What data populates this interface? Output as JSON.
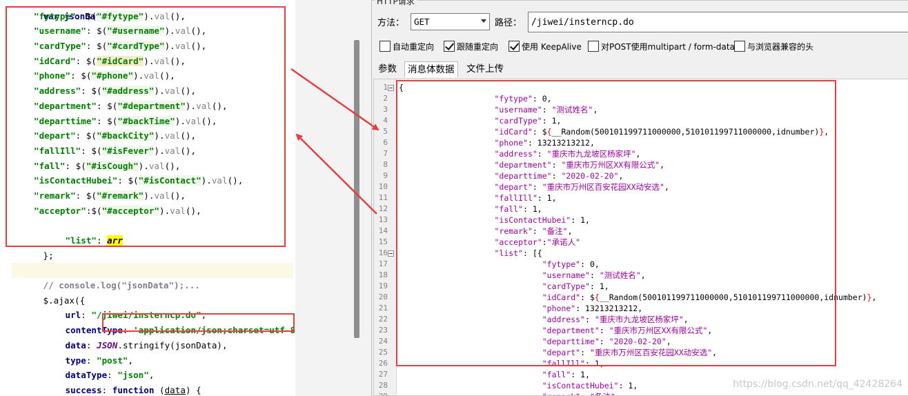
{
  "left_editor": {
    "line_partial": "var jsonData = {",
    "fields": [
      {
        "key": "\"fytype\"",
        "sel": "\"#fytype\""
      },
      {
        "key": "\"username\"",
        "sel": "\"#username\""
      },
      {
        "key": "\"cardType\"",
        "sel": "\"#cardType\""
      },
      {
        "key": "\"idCard\"",
        "sel": "\"#idCard\""
      },
      {
        "key": "\"phone\"",
        "sel": "\"#phone\""
      },
      {
        "key": "\"address\"",
        "sel": "\"#address\""
      },
      {
        "key": "\"department\"",
        "sel": "\"#department\""
      },
      {
        "key": "\"departtime\"",
        "sel": "\"#backTime\""
      },
      {
        "key": "\"depart\"",
        "sel": "\"#backCity\""
      },
      {
        "key": "\"fallIll\"",
        "sel": "\"#isFever\""
      },
      {
        "key": "\"fall\"",
        "sel": "\"#isCough\""
      },
      {
        "key": "\"isContactHubei\"",
        "sel": "\"#isContact\""
      },
      {
        "key": "\"remark\"",
        "sel": "\"#remark\""
      },
      {
        "key": "\"acceptor\"",
        "sel": "\"#acceptor\""
      }
    ],
    "list_key": "\"list\"",
    "list_val": "arr",
    "close": "};",
    "comment": "// console.log(\"jsonData\");...",
    "ajax_open": "$.ajax({",
    "url_key": "url",
    "url_val": "\"/jiwei/insterncp.do\"",
    "ct_key": "contentType",
    "ct_val": "'application/json;charset=utf-8'",
    "data_key": "data",
    "data_json": "JSON",
    "data_rest": ".stringify(jsonData),",
    "type_key": "type",
    "type_val": "\"post\"",
    "dt_key": "dataType",
    "dt_val": "\"json\"",
    "succ_key": "success",
    "succ_fn": "function",
    "succ_param": "data"
  },
  "http_panel": {
    "title": "HTTP请求",
    "method_label": "方法：",
    "method_value": "GET",
    "path_label": "路径：",
    "path_value": "/jiwei/insterncp.do",
    "checkboxes": [
      {
        "label": "自动重定向",
        "checked": false
      },
      {
        "label": "跟随重定向",
        "checked": true
      },
      {
        "label": "使用 KeepAlive",
        "checked": true
      },
      {
        "label": "对POST使用multipart / form-data",
        "checked": false
      },
      {
        "label": "与浏览器兼容的头",
        "checked": false
      }
    ],
    "tabs": [
      "参数",
      "消息体数据",
      "文件上传"
    ],
    "active_tab": "消息体数据"
  },
  "body_lines": [
    "{",
    "                    \"fytype\": 0,",
    "                    \"username\": \"测试姓名\",",
    "                    \"cardType\": 1,",
    "                    \"idCard\": ${__Random(500101199711000000,510101199711000000,idnumber)},",
    "                    \"phone\": 13213213212,",
    "                    \"address\": \"重庆市九龙坡区杨家坪\",",
    "                    \"department\": \"重庆市万州区XX有限公式\",",
    "                    \"departtime\": \"2020-02-20\",",
    "                    \"depart\": \"重庆市万州区百安花园XX动安选\",",
    "                    \"fallIll\": 1,",
    "                    \"fall\": 1,",
    "                    \"isContactHubei\": 1,",
    "                    \"remark\": \"备注\",",
    "                    \"acceptor\":\"承诺人\"",
    "                    \"list\": [{",
    "                              \"fytype\": 0,",
    "                              \"username\": \"测试姓名\",",
    "                              \"cardType\": 1,",
    "                              \"idCard\": ${__Random(500101199711000000,510101199711000000,idnumber)},",
    "                              \"phone\": 13213213212,",
    "                              \"address\": \"重庆市九龙坡区杨家坪\",",
    "                              \"department\": \"重庆市万州区XX有限公式\",",
    "                              \"departtime\": \"2020-02-20\",",
    "                              \"depart\": \"重庆市万州区百安花园XX动安选\",",
    "                              \"fallIll\": 1,",
    "                              \"fall\": 1,",
    "                              \"isContactHubei\": 1,",
    "                              \"remark\": \"备注\""
  ],
  "line_numbers": [
    "1",
    "2",
    "3",
    "4",
    "5",
    "6",
    "7",
    "8",
    "9",
    "10",
    "11",
    "12",
    "13",
    "14",
    "15",
    "16",
    "17",
    "18",
    "19",
    "20",
    "21",
    "22",
    "23",
    "24",
    "25",
    "26",
    "27",
    "28",
    "29"
  ],
  "watermark": "https://blog.csdn.net/qq_42428264",
  "colors": {
    "annotation": "#e53e3e",
    "json_key": "#a000a0",
    "code_string": "#008000",
    "keyword": "#000080"
  }
}
